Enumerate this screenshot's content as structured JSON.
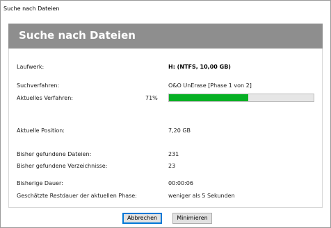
{
  "window": {
    "title": "Suche nach Dateien"
  },
  "header": {
    "title": "Suche nach Dateien"
  },
  "details": {
    "drive_label": "Laufwerk:",
    "drive_value": "H: (NTFS, 10,00 GB)",
    "method_label": "Suchverfahren:",
    "method_value": "O&O UnErase [Phase 1 von 2]",
    "current_method_label": "Aktuelles Verfahren:",
    "progress_percent_text": "71%",
    "progress_value": 0.55,
    "position_label": "Aktuelle Position:",
    "position_value": "7,20 GB",
    "files_found_label": "Bisher gefundene Dateien:",
    "files_found_value": "231",
    "dirs_found_label": "Bisher gefundene Verzeichnisse:",
    "dirs_found_value": "23",
    "elapsed_label": "Bisherige Dauer:",
    "elapsed_value": "00:00:06",
    "remaining_label": "Geschätzte Restdauer der aktuellen Phase:",
    "remaining_value": "weniger als 5 Sekunden"
  },
  "buttons": {
    "cancel_label": "Abbrechen",
    "minimize_label": "Minimieren"
  },
  "colors": {
    "progress_fill": "#06b025",
    "header_bg": "#8e8e8e"
  }
}
